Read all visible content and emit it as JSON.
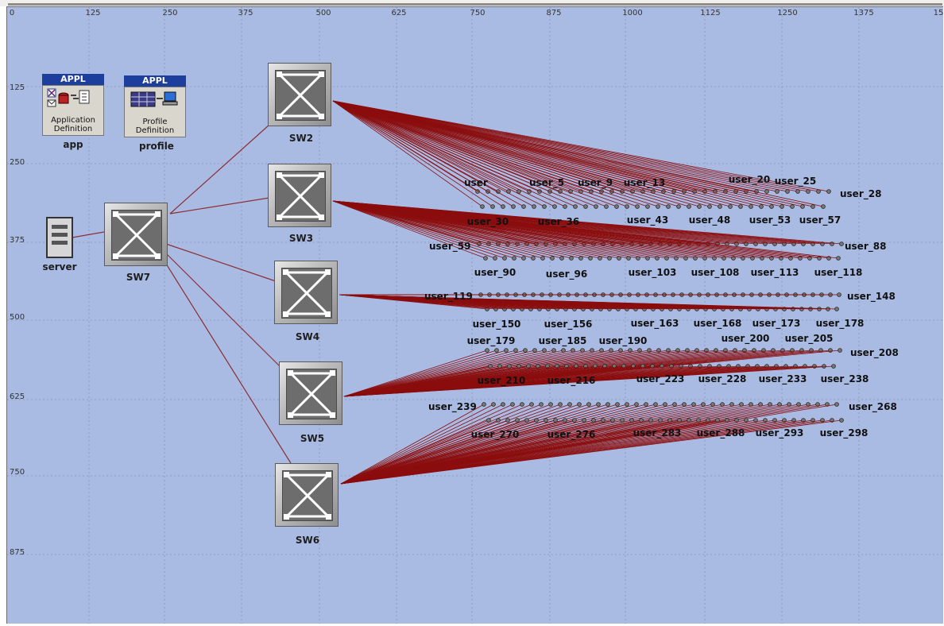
{
  "ruler": {
    "x": [
      "0",
      "125",
      "250",
      "375",
      "500",
      "625",
      "750",
      "875",
      "1000",
      "1125",
      "1250",
      "1375",
      "15"
    ],
    "y": [
      "125",
      "250",
      "375",
      "500",
      "625",
      "750",
      "875"
    ]
  },
  "nodes": {
    "app": {
      "label": "app",
      "header": "APPL",
      "subtitle": "Application Definition"
    },
    "profile": {
      "label": "profile",
      "header": "APPL",
      "subtitle": "Profile Definition"
    },
    "server": {
      "label": "server"
    },
    "switches": [
      "SW2",
      "SW3",
      "SW4",
      "SW5",
      "SW6",
      "SW7"
    ]
  },
  "user_labels": {
    "row1": [
      "user",
      "user_5",
      "user_9",
      "user_13",
      "user_20",
      "user_25",
      "user_28"
    ],
    "row2": [
      "user_30",
      "user_36",
      "user_43",
      "user_48",
      "user_53",
      "user_57"
    ],
    "row3": [
      "user_59",
      "user_88"
    ],
    "row4": [
      "user_90",
      "user_96",
      "user_103",
      "user_108",
      "user_113",
      "user_118"
    ],
    "row5": [
      "user_119",
      "user_148"
    ],
    "row6": [
      "user_150",
      "user_156",
      "user_163",
      "user_168",
      "user_173",
      "user_178"
    ],
    "row7": [
      "user_179",
      "user_185",
      "user_190",
      "user_200",
      "user_205",
      "user_208"
    ],
    "row8": [
      "user_210",
      "user_216",
      "user_223",
      "user_228",
      "user_233",
      "user_238"
    ],
    "row9": [
      "user_239",
      "user_268"
    ],
    "row10": [
      "user_270",
      "user_276",
      "user_283",
      "user_288",
      "user_293",
      "user_298"
    ]
  },
  "colors": {
    "canvas": "#aabbe3",
    "link_switch": "#8b2f35",
    "link_user": "#8b0d0d",
    "appl_header": "#1d3e9c"
  }
}
